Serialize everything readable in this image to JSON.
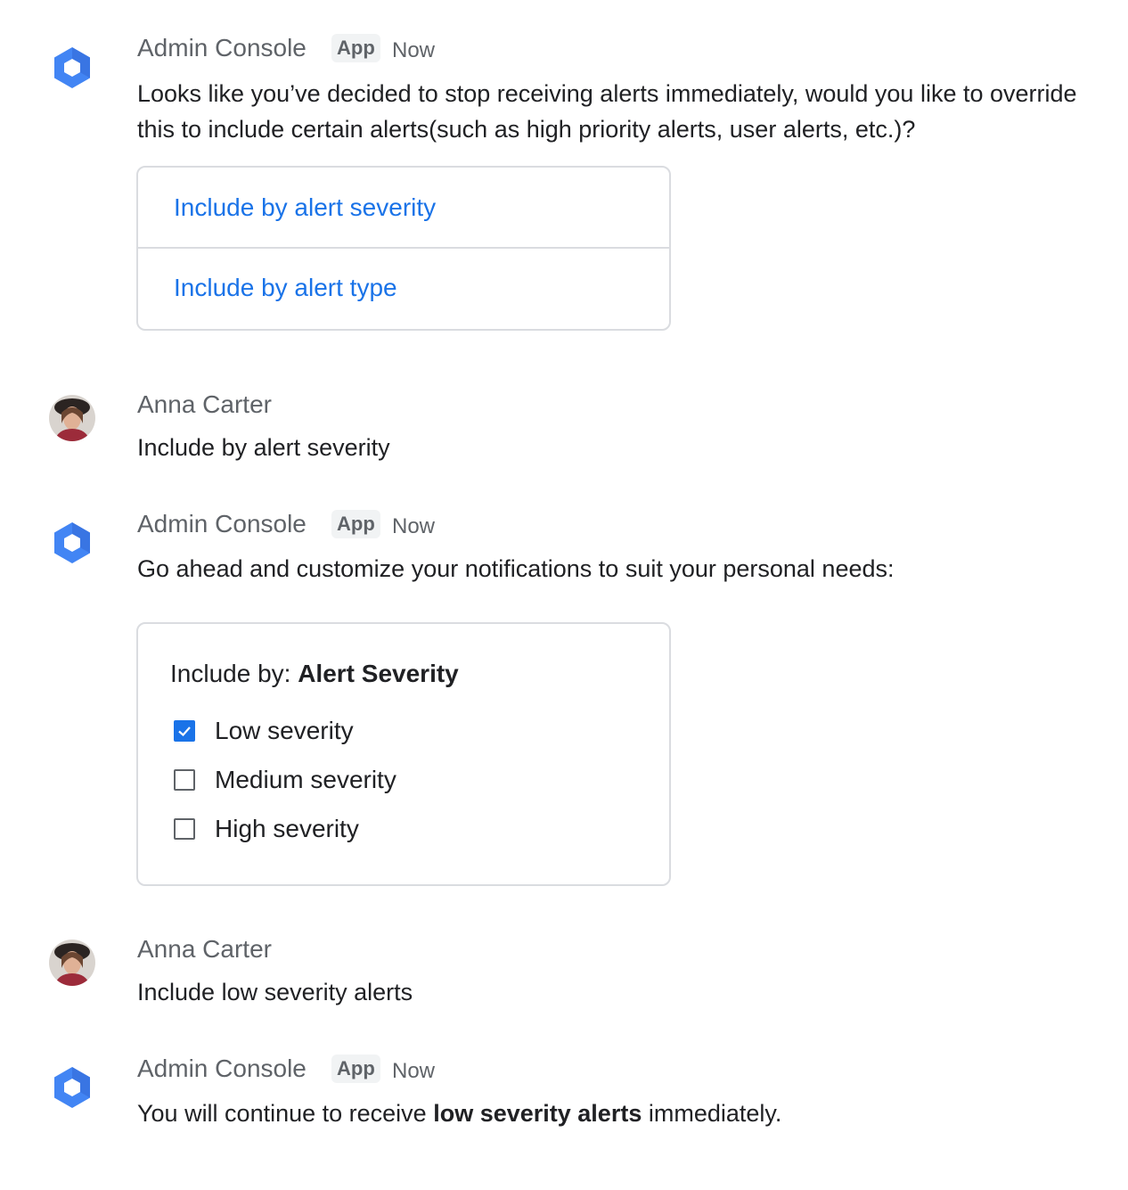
{
  "brand": {
    "app_color": "#4285f4",
    "link_color": "#1a73e8"
  },
  "messages": [
    {
      "sender": "Admin Console",
      "badge": "App",
      "time": "Now",
      "text": "Looks like you’ve decided to stop receiving alerts immediately, would you like to override this to include certain alerts(such as high priority alerts, user alerts, etc.)?",
      "options": [
        "Include by alert severity",
        "Include by alert type"
      ]
    },
    {
      "sender": "Anna Carter",
      "text": "Include by alert severity"
    },
    {
      "sender": "Admin Console",
      "badge": "App",
      "time": "Now",
      "text": "Go ahead and customize your notifications to suit your personal needs:",
      "form": {
        "label": "Include by:",
        "value": "Alert Severity",
        "options": [
          {
            "label": "Low severity",
            "checked": true
          },
          {
            "label": "Medium severity",
            "checked": false
          },
          {
            "label": "High severity",
            "checked": false
          }
        ]
      }
    },
    {
      "sender": "Anna Carter",
      "text": "Include low severity alerts"
    },
    {
      "sender": "Admin Console",
      "badge": "App",
      "time": "Now",
      "text_before": "You will continue to receive ",
      "text_bold": "low severity alerts",
      "text_after": " immediately."
    }
  ]
}
